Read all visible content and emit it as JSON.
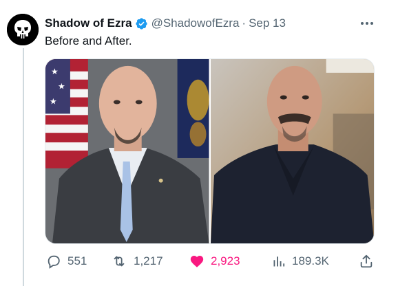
{
  "tweet": {
    "display_name": "Shadow of Ezra",
    "handle": "@ShadowofEzra",
    "separator": "·",
    "date": "Sep 13",
    "text": "Before and After.",
    "verified": true
  },
  "media": {
    "photos": [
      {
        "description_icon": "portrait-photo-suit-flags"
      },
      {
        "description_icon": "portrait-photo-dark-shirt"
      }
    ]
  },
  "actions": {
    "replies": "551",
    "reposts": "1,217",
    "likes": "2,923",
    "views": "189.3K",
    "liked": true
  },
  "colors": {
    "like_pink": "#f91880",
    "verified_blue": "#1d9bf0",
    "muted": "#536471",
    "text": "#0f1419"
  }
}
